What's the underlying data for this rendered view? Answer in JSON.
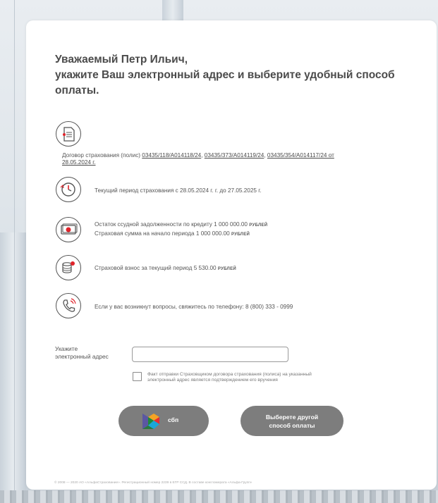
{
  "greeting": {
    "line1": "Уважаемый Петр Ильич,",
    "line2": "укажите Ваш электронный адрес и выберите удобный способ",
    "line3": "оплаты."
  },
  "contract": {
    "prefix": "Договор страхования (полис) ",
    "link1": "03435/118/A014118/24",
    "sep1": ", ",
    "link2": "03435/373/A014119/24",
    "sep2": ", ",
    "link3": "03435/354/A014117/24 от",
    "date_link": "28.05.2024 г."
  },
  "period": {
    "text": "Текущий период страхования с 28.05.2024 г. г. до 27.05.2025 г."
  },
  "loan": {
    "line1": "Остаток ссудной задолженности по кредиту 1 000 000.00 ",
    "line1_unit": "РУБЛЕЙ",
    "line2": "Страховая сумма на начало периода 1 000 000.00 ",
    "line2_unit": "РУБЛЕЙ"
  },
  "premium": {
    "text": "Страховой взнос за текущий период 5 530.00 ",
    "unit": "РУБЛЕЙ"
  },
  "phone": {
    "text": "Если у вас возникнут вопросы, свяжитесь по телефону: 8 (800) 333 - 0999"
  },
  "email": {
    "label_line1": "Укажите",
    "label_line2": "электронный адрес",
    "value": "",
    "placeholder": ""
  },
  "consent": {
    "line1": "Факт отправки Страховщиком договора страхования (полиса) на указанный",
    "line2": "электронный адрес является подтверждением его вручения",
    "checked": false
  },
  "buttons": {
    "sbp_label": "сбп",
    "other_line1": "Выберете другой",
    "other_line2": "способ оплаты"
  },
  "footer": {
    "text": "© 2008 — 2020 АО «АльфаСтрахование». Регистрационный номер 2239 в ЕГР ССД. В составе конгломерата «Альфа-Групп»"
  },
  "colors": {
    "accent_red": "#e0242b",
    "button_gray": "#7d7d7d",
    "text_dark": "#4b4b4b"
  },
  "icons": [
    "document-icon",
    "clock-icon",
    "money-icon",
    "coins-icon",
    "phone-icon",
    "sbp-logo-icon"
  ]
}
